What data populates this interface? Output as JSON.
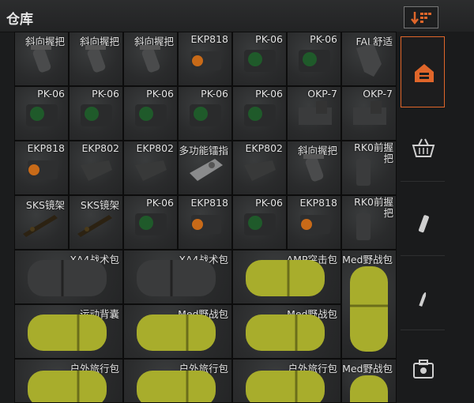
{
  "window": {
    "title": "仓库"
  },
  "colors": {
    "accent": "#e0662a",
    "bag_green": "#a8ad2c",
    "bag_black": "#3a3b3c"
  },
  "toolbar": {
    "sort_icon": "sort-descending-grid-icon"
  },
  "sidebar": {
    "tabs": [
      {
        "name": "warehouse",
        "icon": "warehouse-icon",
        "active": true
      },
      {
        "name": "basket",
        "icon": "basket-icon",
        "active": false
      },
      {
        "name": "magazine",
        "icon": "magazine-icon",
        "active": false
      },
      {
        "name": "ammo",
        "icon": "bullet-icon",
        "active": false
      },
      {
        "name": "medical",
        "icon": "medkit-icon",
        "active": false
      }
    ]
  },
  "items": {
    "r1": [
      "斜向握把",
      "斜向握把",
      "斜向握把",
      "EKP818",
      "PK-06",
      "PK-06",
      "FAL舒适"
    ],
    "r2": [
      "PK-06",
      "PK-06",
      "PK-06",
      "PK-06",
      "PK-06",
      "OKP-7",
      "OKP-7"
    ],
    "r3": [
      "EKP818",
      "EKP802",
      "EKP802",
      "多功能镭指",
      "EKP802",
      "斜向握把",
      "RK0前握把"
    ],
    "r4": [
      "SKS镜架",
      "SKS镜架",
      "PK-06",
      "EKP818",
      "PK-06",
      "EKP818",
      "RK0前握把"
    ],
    "bags_r5": [
      "XA4战术包",
      "XA4战术包",
      "AMP突击包",
      "Med野战包"
    ],
    "bags_r6": [
      "运动背囊",
      "Med野战包",
      "Med野战包"
    ],
    "bags_r7": [
      "户外旅行包",
      "户外旅行包",
      "户外旅行包",
      "Med野战包"
    ]
  }
}
